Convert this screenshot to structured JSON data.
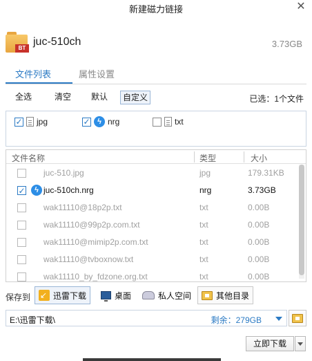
{
  "window": {
    "title": "新建磁力链接",
    "close_glyph": "✕"
  },
  "file": {
    "name": "juc-510ch",
    "size": "3.73GB",
    "badge": "BT"
  },
  "tabs": [
    {
      "label": "文件列表",
      "active": true
    },
    {
      "label": "属性设置",
      "active": false
    }
  ],
  "filter_buttons": [
    {
      "label": "全选"
    },
    {
      "label": "清空"
    },
    {
      "label": "默认"
    },
    {
      "label": "自定义",
      "active": true
    }
  ],
  "selected_info": "已选：1个文件",
  "file_types": [
    {
      "label": "jpg",
      "checked": true,
      "icon": "document-icon"
    },
    {
      "label": "nrg",
      "checked": true,
      "icon": "xunlei-icon"
    },
    {
      "label": "txt",
      "checked": false,
      "icon": "document-icon"
    }
  ],
  "table": {
    "headers": {
      "name": "文件名称",
      "type": "类型",
      "size": "大小"
    },
    "rows": [
      {
        "name": "juc-510.jpg",
        "type": "jpg",
        "size": "179.31KB",
        "checked": false,
        "selected": false
      },
      {
        "name": "juc-510ch.nrg",
        "type": "nrg",
        "size": "3.73GB",
        "checked": true,
        "selected": true
      },
      {
        "name": "wak11110@18p2p.txt",
        "type": "txt",
        "size": "0.00B",
        "checked": false,
        "selected": false
      },
      {
        "name": "wak11110@99p2p.com.txt",
        "type": "txt",
        "size": "0.00B",
        "checked": false,
        "selected": false
      },
      {
        "name": "wak11110@mimip2p.com.txt",
        "type": "txt",
        "size": "0.00B",
        "checked": false,
        "selected": false
      },
      {
        "name": "wak11110@tvboxnow.txt",
        "type": "txt",
        "size": "0.00B",
        "checked": false,
        "selected": false
      },
      {
        "name": "wak11110_by_fdzone.org.txt",
        "type": "txt",
        "size": "0.00B",
        "checked": false,
        "selected": false
      }
    ]
  },
  "save": {
    "label": "保存到",
    "locations": [
      {
        "label": "迅雷下载",
        "icon": "xunlei-download-icon",
        "active": true
      },
      {
        "label": "桌面",
        "icon": "desktop-icon",
        "active": false
      },
      {
        "label": "私人空间",
        "icon": "private-space-icon",
        "active": false
      },
      {
        "label": "其他目录",
        "icon": "folder-icon",
        "active": false
      }
    ]
  },
  "path": {
    "value": "E:\\迅雷下载\\",
    "free_space": "剩余：279GB"
  },
  "download_button": "立即下载",
  "colors": {
    "accent": "#2b7ac4",
    "muted_text": "#a0a0a0"
  }
}
